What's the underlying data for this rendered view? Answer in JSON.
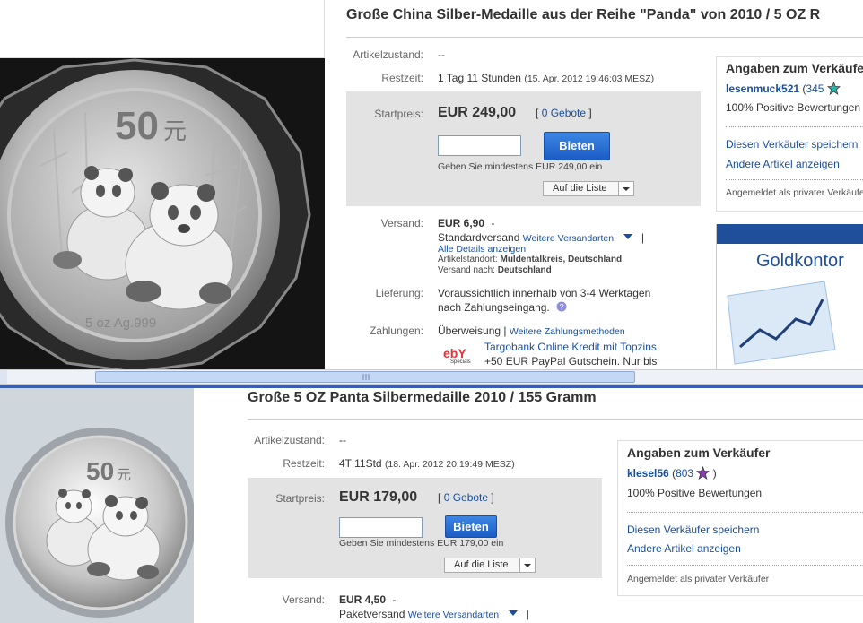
{
  "top": {
    "title": "Große China Silber-Medaille aus der Reihe \"Panda\" von 2010 / 5 OZ R",
    "labels": {
      "condition": "Artikelzustand:",
      "time_left": "Restzeit:",
      "start_price": "Startpreis:",
      "shipping": "Versand:",
      "delivery": "Lieferung:",
      "payment": "Zahlungen:"
    },
    "condition_value": "--",
    "time_left_value": "1 Tag 11 Stunden",
    "end_time": "(15. Apr. 2012 19:46:03 MESZ)",
    "price": "EUR 249,00",
    "bids_count": "0 Gebote",
    "bracket_open": "[",
    "bracket_close": "]",
    "bid_button": "Bieten",
    "min_bid_hint": "Geben Sie mindestens EUR 249,00 ein",
    "watch_button": "Auf die Liste",
    "shipping_cost": "EUR 6,90",
    "shipping_dash": "-",
    "shipping_method": "Standardversand",
    "more_shipping": "Weitere Versandarten",
    "pipe": "|",
    "all_details": "Alle Details anzeigen",
    "item_location_label": "Artikelstandort:",
    "item_location": "Muldentalkreis, Deutschland",
    "ships_to_label": "Versand nach:",
    "ships_to": "Deutschland",
    "delivery_line1": "Voraussichtlich innerhalb von 3-4 Werktagen",
    "delivery_line2": "nach Zahlungseingang.",
    "payment_method": "Überweisung",
    "more_payment": "Weitere Zahlungsmethoden",
    "ad_logo": "ebY",
    "ad_logo_sub": "Specials",
    "ad_line1": "Targobank Online Kredit mit Topzins",
    "ad_line2": "+50 EUR PayPal Gutschein. Nur bis",
    "seller_heading": "Angaben zum Verkäufer",
    "seller_name": "lesenmuck521",
    "seller_score": "345",
    "seller_positive": "100% Positive Bewertungen",
    "save_seller": "Diesen Verkäufer speichern",
    "other_items": "Andere Artikel anzeigen",
    "registered_as": "Angemeldet als privater Verkäufer",
    "banner_text": "Goldkontor",
    "star_color": "#2bb3a8"
  },
  "bottom": {
    "title": "Große 5 OZ Panta Silbermedaille 2010 / 155 Gramm",
    "labels": {
      "condition": "Artikelzustand:",
      "time_left": "Restzeit:",
      "start_price": "Startpreis:",
      "shipping": "Versand:"
    },
    "condition_value": "--",
    "time_left_value": "4T 11Std",
    "end_time": "(18. Apr. 2012 20:19:49 MESZ)",
    "price": "EUR 179,00",
    "bids_count": "0 Gebote",
    "bracket_open": "[",
    "bracket_close": "]",
    "bid_button": "Bieten",
    "min_bid_hint": "Geben Sie mindestens EUR 179,00 ein",
    "watch_button": "Auf die Liste",
    "shipping_cost": "EUR 4,50",
    "shipping_dash": "-",
    "shipping_method": "Paketversand",
    "more_shipping": "Weitere Versandarten",
    "pipe": "|",
    "seller_heading": "Angaben zum Verkäufer",
    "seller_name": "klesel56",
    "seller_score": "803",
    "seller_positive": "100% Positive Bewertungen",
    "save_seller": "Diesen Verkäufer speichern",
    "other_items": "Andere Artikel anzeigen",
    "registered_as": "Angemeldet als privater Verkäufer",
    "star_color": "#8a3fb0"
  },
  "coin": {
    "denomination": "50",
    "currency_glyph": "元",
    "weight_text": "5 oz Ag.999"
  },
  "colors": {
    "link": "#1a4fa0",
    "bid_button": "#2a70d6",
    "banner_blue": "#1f4e9a",
    "scrollbar": "#c4d7f5"
  }
}
